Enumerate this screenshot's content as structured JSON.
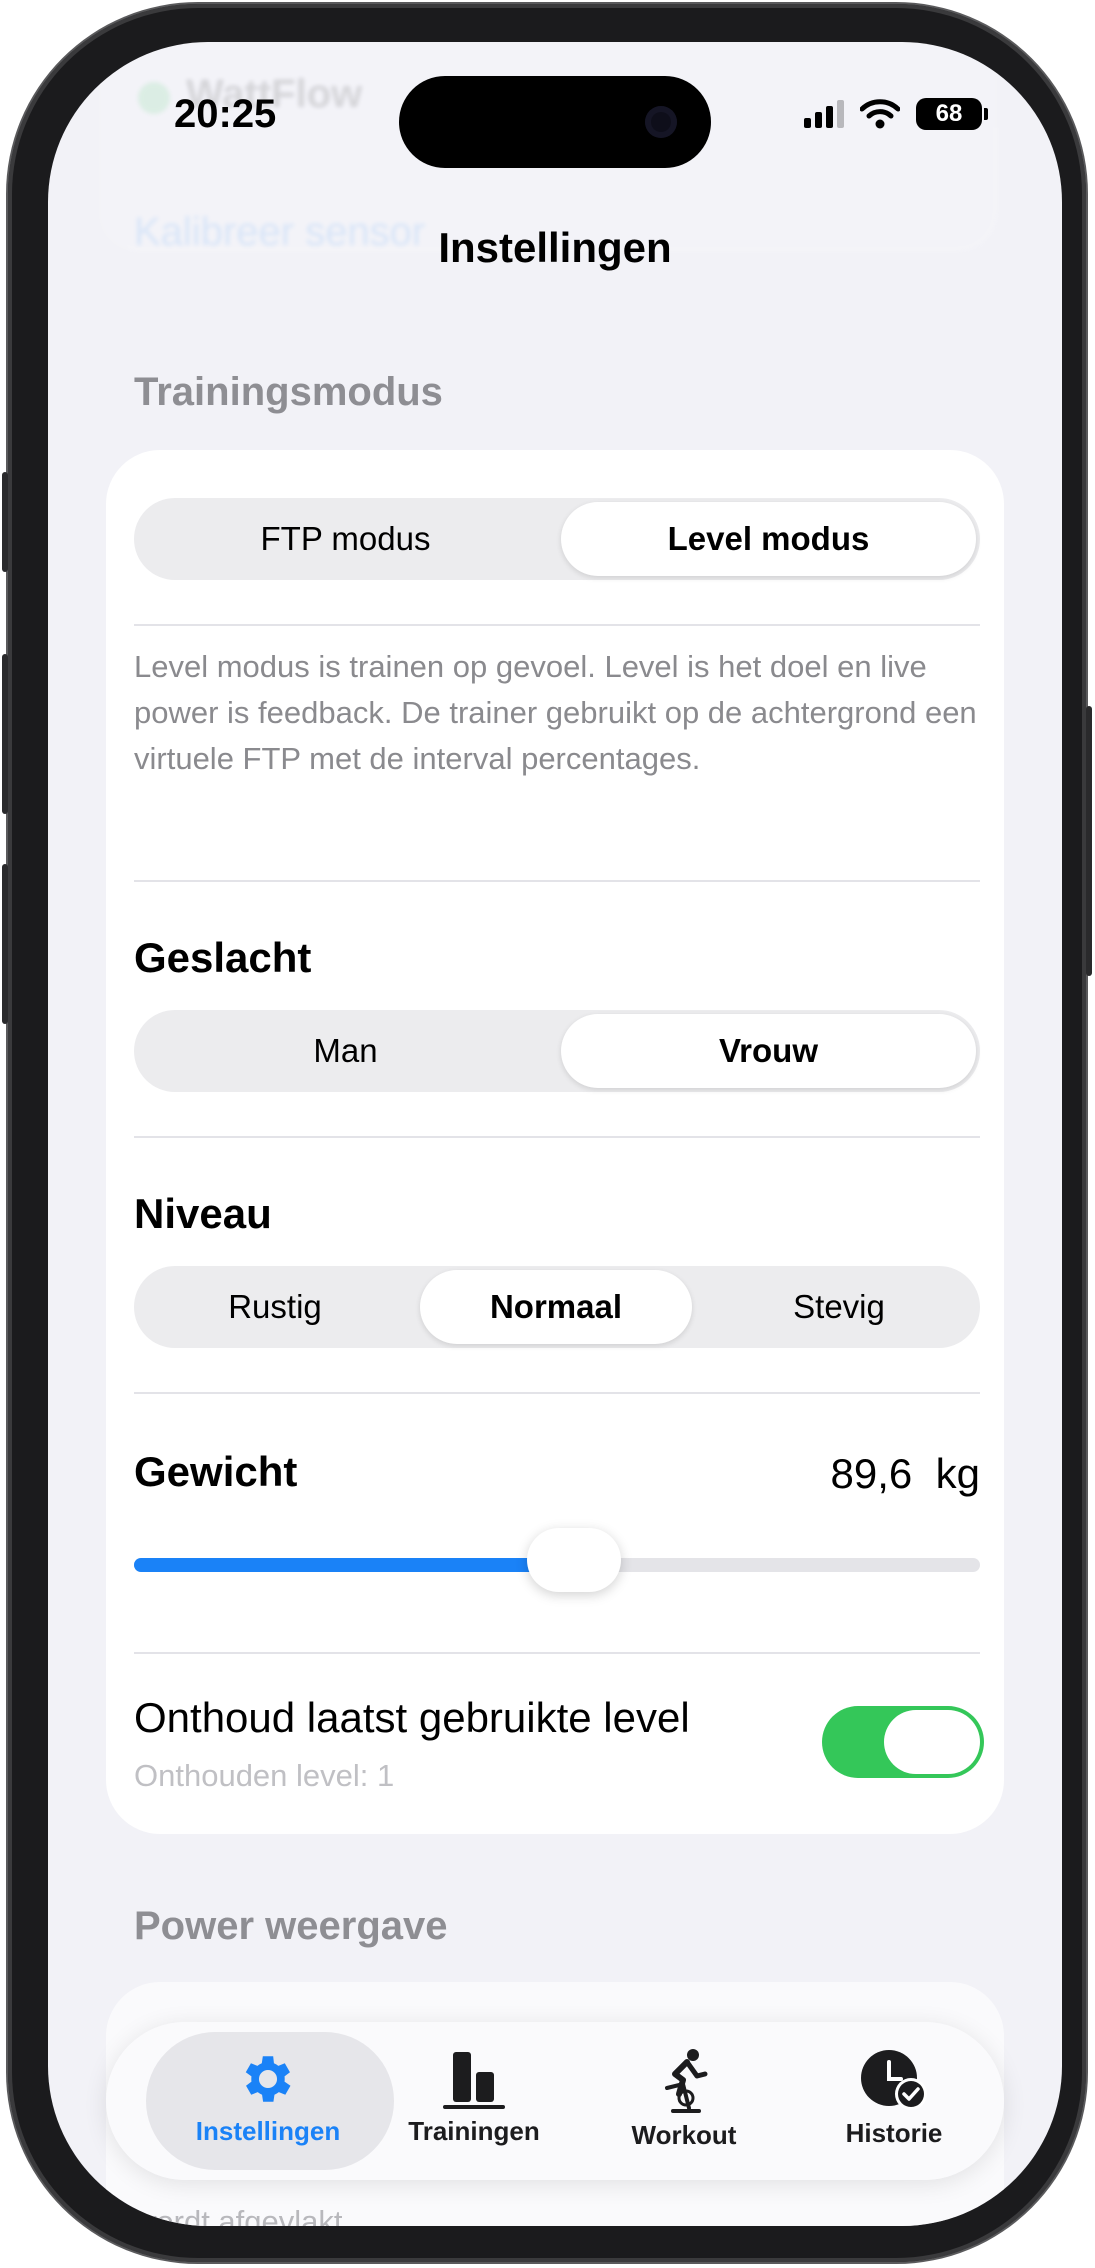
{
  "status_bar": {
    "time": "20:25",
    "battery": "68"
  },
  "nav": {
    "title": "Instellingen"
  },
  "faded_top": {
    "device_text": "WattFlow",
    "link": "Kalibreer sensor"
  },
  "training_section": {
    "header": "Trainingsmodus",
    "mode_segment": {
      "options": [
        "FTP modus",
        "Level modus"
      ],
      "selected": "Level modus"
    },
    "description": "Level modus is trainen op gevoel. Level is het doel en live power is feedback. De trainer gebruikt op de achtergrond een virtuele FTP met de interval percentages.",
    "gender": {
      "title": "Geslacht",
      "options": [
        "Man",
        "Vrouw"
      ],
      "selected": "Vrouw"
    },
    "level": {
      "title": "Niveau",
      "options": [
        "Rustig",
        "Normaal",
        "Stevig"
      ],
      "selected": "Normaal"
    },
    "weight": {
      "title": "Gewicht",
      "value": "89,6",
      "unit": "kg",
      "slider_fraction": 0.52
    },
    "remember": {
      "title": "Onthoud laatst gebruikte level",
      "subtitle": "Onthouden level: 1",
      "enabled": true
    }
  },
  "power_section": {
    "header": "Power weergave",
    "footer_text": "wordt afgevlakt."
  },
  "tabbar": {
    "tabs": [
      {
        "label": "Instellingen",
        "icon": "gear-icon",
        "active": true
      },
      {
        "label": "Trainingen",
        "icon": "chart-bars-icon",
        "active": false
      },
      {
        "label": "Workout",
        "icon": "bike-rider-icon",
        "active": false
      },
      {
        "label": "Historie",
        "icon": "clock-check-icon",
        "active": false
      }
    ]
  },
  "colors": {
    "accent": "#1a82f7",
    "toggle_on": "#34c759",
    "background": "#f2f2f7",
    "secondary_text": "#8e8e93"
  }
}
